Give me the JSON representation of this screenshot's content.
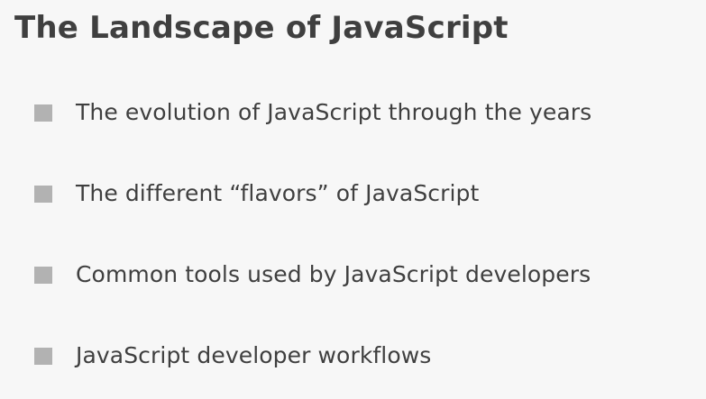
{
  "slide": {
    "title": "The Landscape of JavaScript",
    "bullets": [
      {
        "icon": "square-bullet-icon",
        "text": "The evolution of JavaScript through the years"
      },
      {
        "icon": "square-bullet-icon",
        "text": "The different “flavors” of JavaScript"
      },
      {
        "icon": "square-bullet-icon",
        "text": "Common tools used by JavaScript developers"
      },
      {
        "icon": "square-bullet-icon",
        "text": "JavaScript developer workflows"
      }
    ]
  },
  "colors": {
    "background": "#f7f7f7",
    "text": "#3f3f3f",
    "bullet": "#b2b2b2"
  }
}
